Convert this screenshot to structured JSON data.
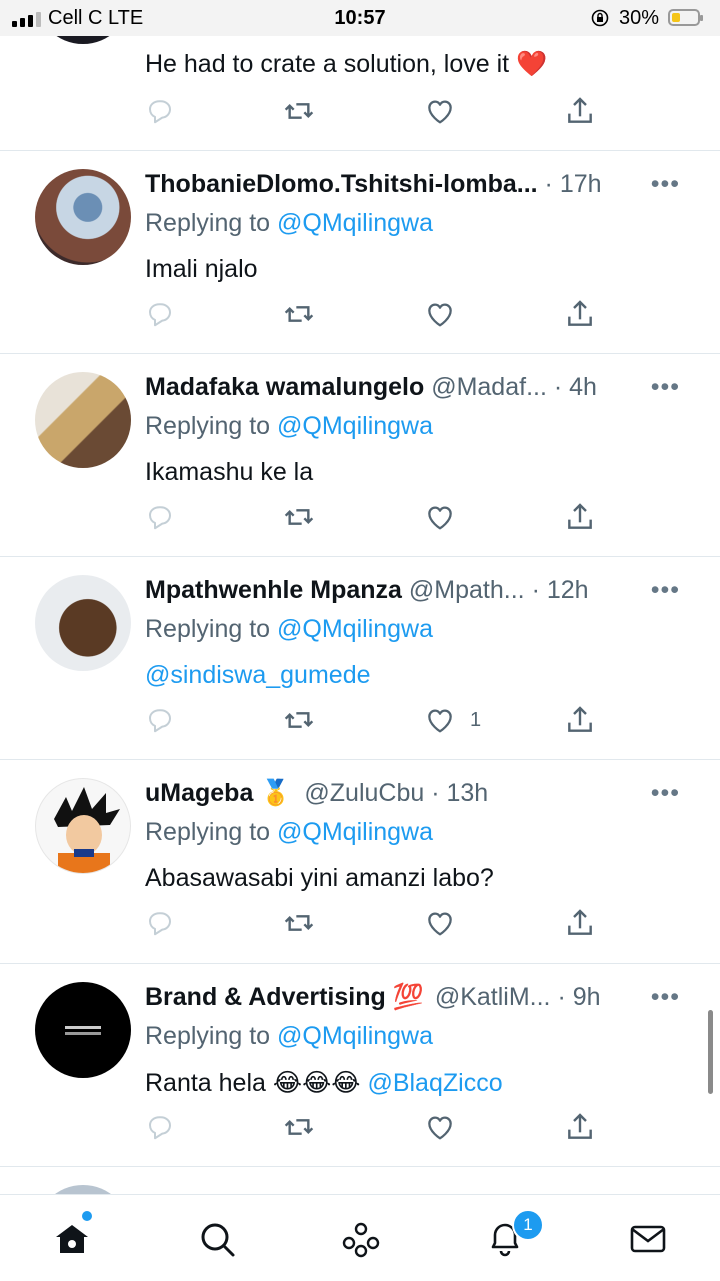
{
  "status_bar": {
    "carrier": "Cell C  LTE",
    "time": "10:57",
    "battery": "30%"
  },
  "tweets": [
    {
      "body": "He had to crate a solution, love it ❤️"
    },
    {
      "name": "ThobanieDlomo.Tshitshi-lomba...",
      "handle": "",
      "time": "17h",
      "replying_prefix": "Replying to ",
      "replying_to": "@QMqilingwa",
      "body": "Imali njalo"
    },
    {
      "name": "Madafaka wamalungelo",
      "handle": "@Madaf...",
      "time": "4h",
      "replying_prefix": "Replying to ",
      "replying_to": "@QMqilingwa",
      "body": "Ikamashu ke la"
    },
    {
      "name": "Mpathwenhle Mpanza",
      "handle": "@Mpath...",
      "time": "12h",
      "replying_prefix": "Replying to ",
      "replying_to": "@QMqilingwa",
      "body_mention": "@sindiswa_gumede",
      "like_count": "1"
    },
    {
      "name": "uMageba 🥇",
      "handle": "@ZuluCbu",
      "time": "13h",
      "replying_prefix": "Replying to ",
      "replying_to": "@QMqilingwa",
      "body": "Abasawasabi yini amanzi labo?"
    },
    {
      "name": "Brand & Advertising 💯",
      "handle": "@KatliM...",
      "time": "9h",
      "replying_prefix": "Replying to ",
      "replying_to": "@QMqilingwa",
      "body": "Ranta hela 😂😂😂 ",
      "body_mention": "@BlaqZicco"
    }
  ],
  "bottom_nav": {
    "notifications_badge": "1"
  },
  "icons": [
    "home-icon",
    "search-icon",
    "spaces-icon",
    "notifications-icon",
    "messages-icon",
    "reply-icon",
    "retweet-icon",
    "like-icon",
    "share-icon",
    "more-icon"
  ]
}
